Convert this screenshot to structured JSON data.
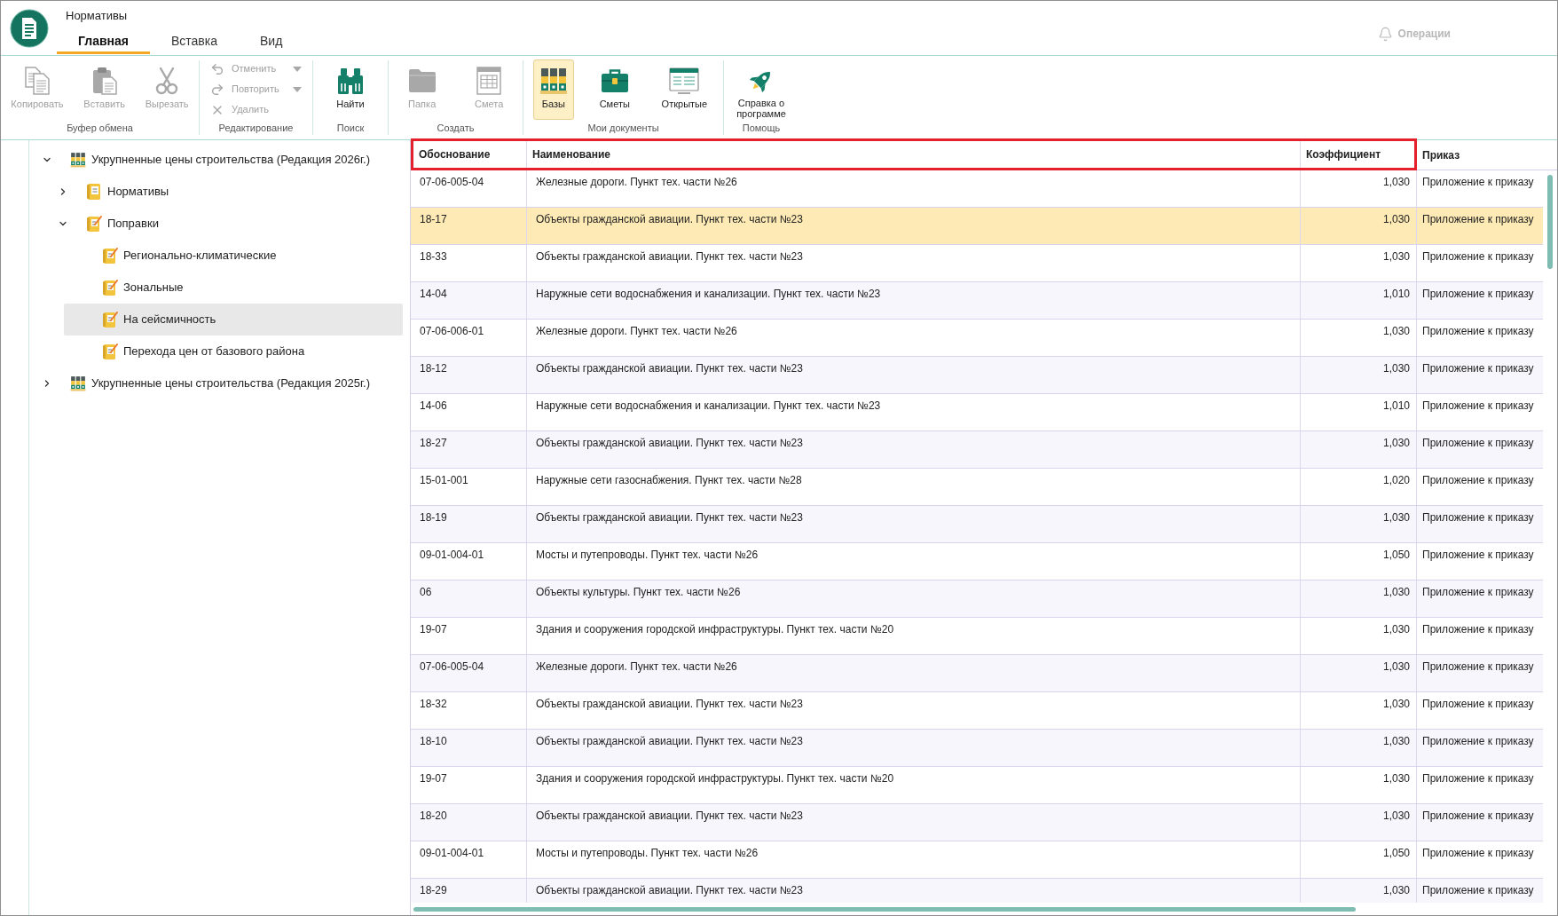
{
  "window": {
    "title": "Нормативы"
  },
  "tabs": [
    {
      "label": "Главная",
      "selected": true
    },
    {
      "label": "Вставка",
      "selected": false
    },
    {
      "label": "Вид",
      "selected": false
    }
  ],
  "operations": {
    "label": "Операции",
    "disabled": true
  },
  "ribbon": {
    "groups": [
      {
        "label": "Буфер обмена",
        "buttons": [
          {
            "label": "Копировать",
            "kind": "large",
            "disabled": true
          },
          {
            "label": "Вставить",
            "kind": "large",
            "disabled": true
          },
          {
            "label": "Вырезать",
            "kind": "large",
            "disabled": true
          }
        ]
      },
      {
        "label": "Редактирование",
        "buttons": [
          {
            "label": "Отменить",
            "kind": "small",
            "disabled": true,
            "dropdown": true
          },
          {
            "label": "Повторить",
            "kind": "small",
            "disabled": true,
            "dropdown": true
          },
          {
            "label": "Удалить",
            "kind": "small",
            "disabled": true,
            "dropdown": false
          }
        ]
      },
      {
        "label": "Поиск",
        "buttons": [
          {
            "label": "Найти",
            "kind": "large",
            "disabled": false
          }
        ]
      },
      {
        "label": "Создать",
        "buttons": [
          {
            "label": "Папка",
            "kind": "large",
            "disabled": true
          },
          {
            "label": "Смета",
            "kind": "large",
            "disabled": true
          }
        ]
      },
      {
        "label": "Мои документы",
        "buttons": [
          {
            "label": "Базы",
            "kind": "large",
            "disabled": false,
            "selected": true
          },
          {
            "label": "Сметы",
            "kind": "large",
            "disabled": false,
            "selected": false
          },
          {
            "label": "Открытые",
            "kind": "large",
            "disabled": false,
            "selected": false
          }
        ]
      },
      {
        "label": "Помощь",
        "buttons": [
          {
            "label": "Справка о программе",
            "kind": "large",
            "disabled": false
          }
        ]
      }
    ]
  },
  "tree": [
    {
      "label": "Укрупненные цены строительства (Редакция 2026г.)",
      "kind": "base",
      "expanded": true,
      "selected": false,
      "children": [
        {
          "label": "Нормативы",
          "kind": "catalog",
          "expanded": false,
          "selected": false
        },
        {
          "label": "Поправки",
          "kind": "corrections",
          "expanded": true,
          "selected": false,
          "children": [
            {
              "label": "Регионально-климатические",
              "kind": "corrections",
              "selected": false
            },
            {
              "label": "Зональные",
              "kind": "corrections",
              "selected": false
            },
            {
              "label": "На сейсмичность",
              "kind": "corrections",
              "selected": true
            },
            {
              "label": "Перехода цен от базового района",
              "kind": "corrections",
              "selected": false
            }
          ]
        }
      ]
    },
    {
      "label": "Укрупненные цены строительства (Редакция 2025г.)",
      "kind": "base",
      "expanded": false,
      "selected": false
    }
  ],
  "table": {
    "columns": [
      {
        "label": "Обоснование",
        "highlighted": true
      },
      {
        "label": "Наименование",
        "highlighted": true
      },
      {
        "label": "Коэффициент",
        "highlighted": true
      },
      {
        "label": "Приказ",
        "highlighted": false
      }
    ],
    "rows": [
      {
        "cells": [
          "07-06-005-04",
          "Железные дороги. Пункт тех. части №26",
          "1,030",
          "Приложение к приказу"
        ],
        "selected": false
      },
      {
        "cells": [
          "18-17",
          "Объекты гражданской авиации. Пункт тех. части №23",
          "1,030",
          "Приложение к приказу"
        ],
        "selected": true
      },
      {
        "cells": [
          "18-33",
          "Объекты гражданской авиации. Пункт тех. части №23",
          "1,030",
          "Приложение к приказу"
        ],
        "selected": false
      },
      {
        "cells": [
          "14-04",
          "Наружные сети водоснабжения и канализации. Пункт тех. части №23",
          "1,010",
          "Приложение к приказу"
        ],
        "selected": false
      },
      {
        "cells": [
          "07-06-006-01",
          "Железные дороги. Пункт тех. части №26",
          "1,030",
          "Приложение к приказу"
        ],
        "selected": false
      },
      {
        "cells": [
          "18-12",
          "Объекты гражданской авиации. Пункт тех. части №23",
          "1,030",
          "Приложение к приказу"
        ],
        "selected": false
      },
      {
        "cells": [
          "14-06",
          "Наружные сети водоснабжения и канализации. Пункт тех. части №23",
          "1,010",
          "Приложение к приказу"
        ],
        "selected": false
      },
      {
        "cells": [
          "18-27",
          "Объекты гражданской авиации. Пункт тех. части №23",
          "1,030",
          "Приложение к приказу"
        ],
        "selected": false
      },
      {
        "cells": [
          "15-01-001",
          "Наружные сети газоснабжения. Пункт тех. части №28",
          "1,020",
          "Приложение к приказу"
        ],
        "selected": false
      },
      {
        "cells": [
          "18-19",
          "Объекты гражданской авиации. Пункт тех. части №23",
          "1,030",
          "Приложение к приказу"
        ],
        "selected": false
      },
      {
        "cells": [
          "09-01-004-01",
          "Мосты и путепроводы. Пункт тех. части №26",
          "1,050",
          "Приложение к приказу"
        ],
        "selected": false
      },
      {
        "cells": [
          "06",
          "Объекты культуры. Пункт тех. части №26",
          "1,030",
          "Приложение к приказу"
        ],
        "selected": false
      },
      {
        "cells": [
          "19-07",
          "Здания и сооружения городской инфраструктуры. Пункт тех. части №20",
          "1,030",
          "Приложение к приказу"
        ],
        "selected": false
      },
      {
        "cells": [
          "07-06-005-04",
          "Железные дороги. Пункт тех. части №26",
          "1,030",
          "Приложение к приказу"
        ],
        "selected": false
      },
      {
        "cells": [
          "18-32",
          "Объекты гражданской авиации. Пункт тех. части №23",
          "1,030",
          "Приложение к приказу"
        ],
        "selected": false
      },
      {
        "cells": [
          "18-10",
          "Объекты гражданской авиации. Пункт тех. части №23",
          "1,030",
          "Приложение к приказу"
        ],
        "selected": false
      },
      {
        "cells": [
          "19-07",
          "Здания и сооружения городской инфраструктуры. Пункт тех. части №20",
          "1,030",
          "Приложение к приказу"
        ],
        "selected": false
      },
      {
        "cells": [
          "18-20",
          "Объекты гражданской авиации. Пункт тех. части №23",
          "1,030",
          "Приложение к приказу"
        ],
        "selected": false
      },
      {
        "cells": [
          "09-01-004-01",
          "Мосты и путепроводы. Пункт тех. части №26",
          "1,050",
          "Приложение к приказу"
        ],
        "selected": false
      },
      {
        "cells": [
          "18-29",
          "Объекты гражданской авиации. Пункт тех. части №23",
          "1,030",
          "Приложение к приказу"
        ],
        "selected": false
      }
    ]
  }
}
